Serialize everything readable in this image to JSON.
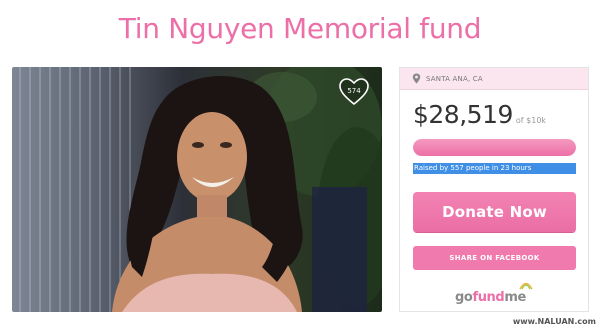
{
  "page": {
    "title": "Tin Nguyen Memorial fund"
  },
  "photo": {
    "likes": "574"
  },
  "panel": {
    "location": "SANTA ANA, CA",
    "amount": "$28,519",
    "goal": "of $10k",
    "progress_fraction": 1.0,
    "raised_text": "Raised by 557 people in 23 hours",
    "donate_label": "Donate Now",
    "share_label": "SHARE ON FACEBOOK",
    "logo": {
      "go": "go",
      "fund": "fund",
      "me": "me"
    }
  },
  "watermark": "www.NALUAN.com",
  "colors": {
    "brand_pink": "#ec6fa7",
    "raised_blue": "#3f8fe6"
  }
}
